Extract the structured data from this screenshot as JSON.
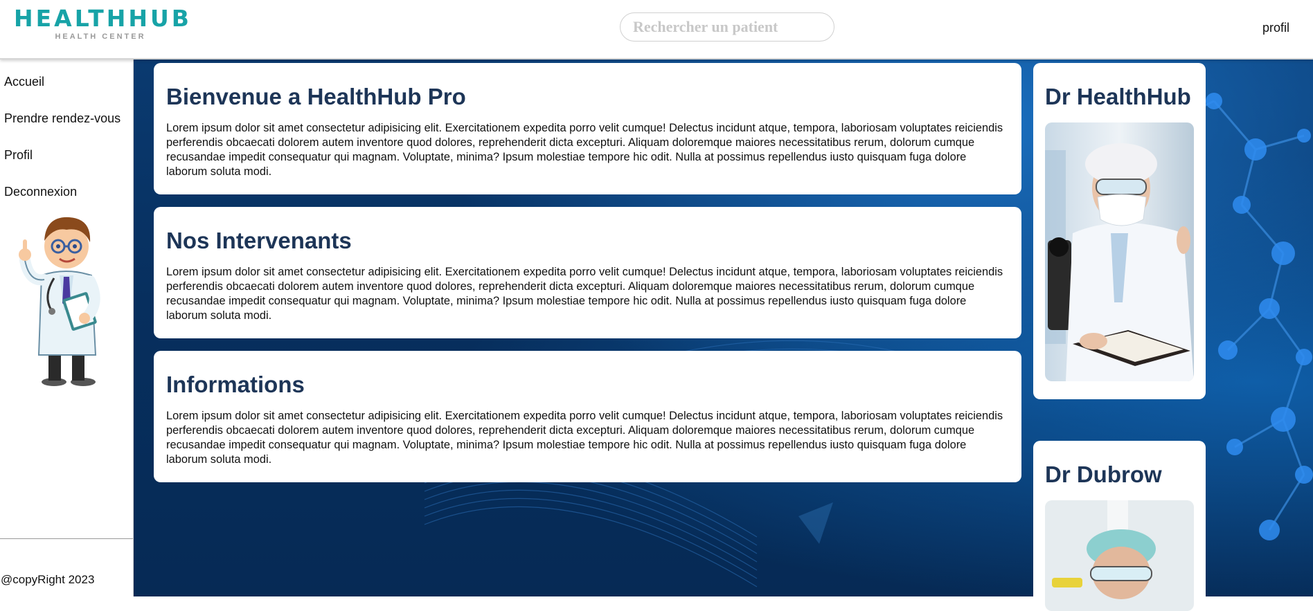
{
  "header": {
    "logo_title": "HEALTHHUB",
    "logo_subtitle": "HEALTH CENTER",
    "search_placeholder": "Rechercher un patient",
    "profile_link": "profil"
  },
  "sidebar": {
    "items": [
      {
        "label": "Accueil"
      },
      {
        "label": "Prendre rendez-vous"
      },
      {
        "label": "Profil"
      },
      {
        "label": "Deconnexion"
      }
    ],
    "copyright": "@copyRight 2023"
  },
  "main": {
    "sections": [
      {
        "title": "Bienvenue a HealthHub Pro",
        "body": "Lorem ipsum dolor sit amet consectetur adipisicing elit. Exercitationem expedita porro velit cumque! Delectus incidunt atque, tempora, laboriosam voluptates reiciendis perferendis obcaecati dolorem autem inventore quod dolores, reprehenderit dicta excepturi. Aliquam doloremque maiores necessitatibus rerum, dolorum cumque recusandae impedit consequatur qui magnam. Voluptate, minima? Ipsum molestiae tempore hic odit. Nulla at possimus repellendus iusto quisquam fuga dolore laborum soluta modi."
      },
      {
        "title": "Nos Intervenants",
        "body": "Lorem ipsum dolor sit amet consectetur adipisicing elit. Exercitationem expedita porro velit cumque! Delectus incidunt atque, tempora, laboriosam voluptates reiciendis perferendis obcaecati dolorem autem inventore quod dolores, reprehenderit dicta excepturi. Aliquam doloremque maiores necessitatibus rerum, dolorum cumque recusandae impedit consequatur qui magnam. Voluptate, minima? Ipsum molestiae tempore hic odit. Nulla at possimus repellendus iusto quisquam fuga dolore laborum soluta modi."
      },
      {
        "title": "Informations",
        "body": "Lorem ipsum dolor sit amet consectetur adipisicing elit. Exercitationem expedita porro velit cumque! Delectus incidunt atque, tempora, laboriosam voluptates reiciendis perferendis obcaecati dolorem autem inventore quod dolores, reprehenderit dicta excepturi. Aliquam doloremque maiores necessitatibus rerum, dolorum cumque recusandae impedit consequatur qui magnam. Voluptate, minima? Ipsum molestiae tempore hic odit. Nulla at possimus repellendus iusto quisquam fuga dolore laborum soluta modi."
      }
    ]
  },
  "doctors": [
    {
      "name": "Dr HealthHub"
    },
    {
      "name": "Dr Dubrow"
    }
  ],
  "colors": {
    "brand_teal": "#17a3a7",
    "heading_navy": "#1d3557",
    "background_blue": "#0a3a70"
  },
  "icons": {
    "mascot": "doctor-cartoon-icon"
  }
}
